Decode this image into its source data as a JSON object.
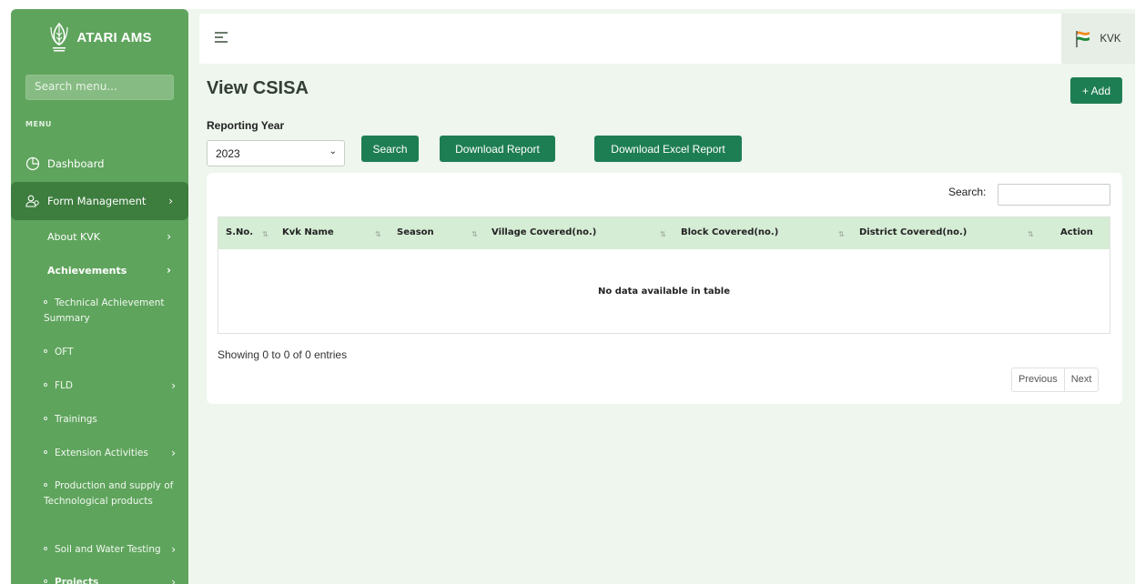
{
  "brand": {
    "name": "ATARI AMS",
    "logo_icon": "icar-wheat-logo"
  },
  "sidebar": {
    "search_placeholder": "Search menu...",
    "menu_heading": "MENU",
    "dashboard": "Dashboard",
    "form_management": "Form Management",
    "about_kvk": "About KVK",
    "achievements": "Achievements",
    "technical_achievement": "Technical Achievement Summary",
    "oft": "OFT",
    "fld": "FLD",
    "trainings": "Trainings",
    "extension_activities": "Extension Activities",
    "production_supply": "Production and supply of Technological products",
    "soil_water": "Soil and Water Testing",
    "projects": "Projects"
  },
  "topbar": {
    "user_label": "KVK",
    "user_icon": "flag-icon"
  },
  "page": {
    "title": "View CSISA",
    "add_label": "+ Add",
    "reporting_year_label": "Reporting Year",
    "selected_year": "2023",
    "search_btn": "Search",
    "download_report_btn": "Download Report",
    "download_excel_btn": "Download Excel Report"
  },
  "table": {
    "search_label": "Search:",
    "columns": [
      "S.No.",
      "Kvk Name",
      "Season",
      "Village Covered(no.)",
      "Block Covered(no.)",
      "District Covered(no.)",
      "Action"
    ],
    "empty_message": "No data available in table",
    "info": "Showing 0 to 0 of 0 entries",
    "prev": "Previous",
    "next": "Next"
  },
  "colors": {
    "sidebar": "#5fa45d",
    "sidebar_active": "#3d7d3e",
    "primary_button": "#1e7e53",
    "table_header": "#d5ecd5",
    "page_bg": "#eef6ee"
  }
}
